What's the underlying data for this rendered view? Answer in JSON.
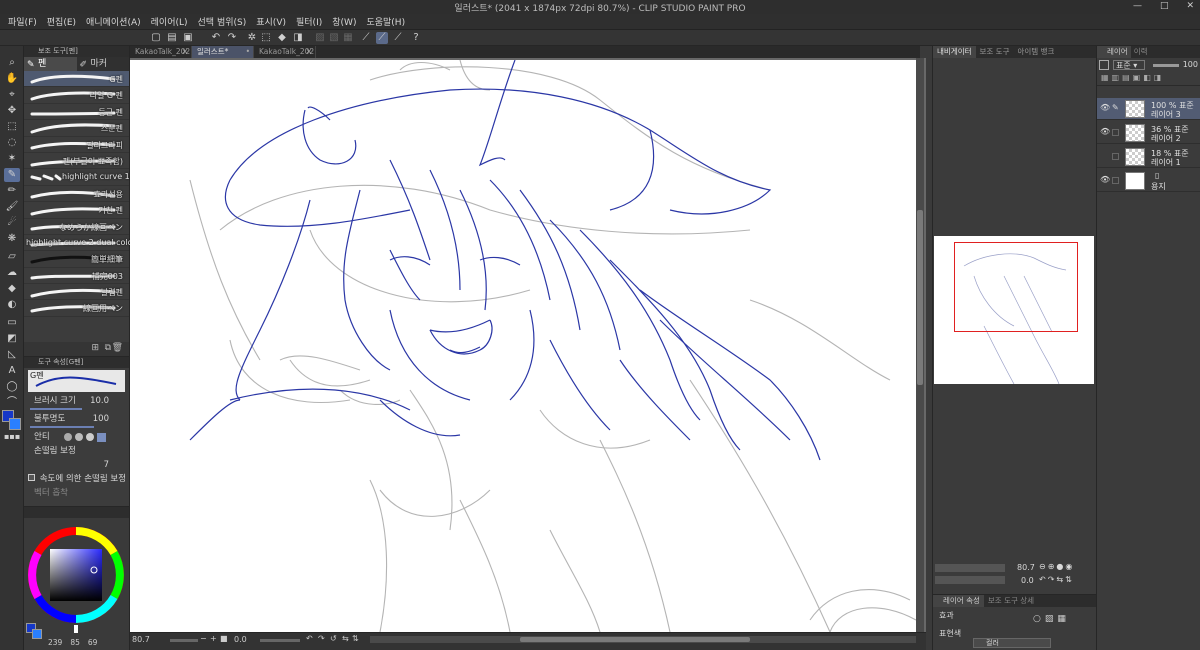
{
  "window": {
    "title": "일러스트* (2041 x 1874px 72dpi 80.7%)  - CLIP STUDIO PAINT PRO",
    "controls": [
      "—",
      "□",
      "✕"
    ]
  },
  "menu": [
    "파일(F)",
    "편집(E)",
    "애니메이션(A)",
    "레이어(L)",
    "선택 범위(S)",
    "표시(V)",
    "필터(I)",
    "창(W)",
    "도움말(H)"
  ],
  "subtool_panel": {
    "header": "보조 도구[펜]",
    "tabs": [
      {
        "label": "펜",
        "icon": "pen-icon"
      },
      {
        "label": "마커",
        "icon": "marker-icon"
      }
    ],
    "brushes": [
      "G펜",
      "리얼 G 펜",
      "둥근 펜",
      "스푼펜",
      "필리그라피",
      "펜(부글이 뾰족함)",
      "highlight curve 1",
      "효과선용",
      "거친 펜",
      "なめらか線画ペン",
      "highlight curve 2 dual color",
      "簡単細筆",
      "補完003",
      "날렵펜",
      "線画用ペン"
    ],
    "selected_index": 0
  },
  "tool_property": {
    "header": "도구 속성[G펜]",
    "name": "G펜",
    "brush_size_label": "브러시 크기",
    "brush_size_value": "10.0",
    "opacity_label": "불투명도",
    "opacity_value": "100",
    "antialias_label": "안티",
    "stabilization_label": "손떨림 보정",
    "stabilization_value": "7",
    "speed_stabilize_label": "속도에 의한 손떨림 보정",
    "vector_snap_label": "벡터 흡착"
  },
  "color": {
    "main": "#1537c8",
    "sub": "#2a7fff",
    "hsv": [
      "239",
      "85",
      "69"
    ],
    "wheel_square_hue": "#2a2a9a"
  },
  "doc_tabs": [
    {
      "label": "KakaoTalk_202",
      "active": false
    },
    {
      "label": "일러스트*",
      "active": true
    },
    {
      "label": "KakaoTalk_202",
      "active": false
    }
  ],
  "status": {
    "zoom": "80.7",
    "rotation": "0.0"
  },
  "navigator": {
    "tabs": [
      "내비게이터",
      "보조 도구",
      "아이템 뱅크"
    ],
    "zoom": "80.7",
    "rotation": "0.0"
  },
  "layers": {
    "tabs": [
      "레이어",
      "이력"
    ],
    "blend": "표준",
    "opacity": "100",
    "items": [
      {
        "opacity": "100 %",
        "blend": "표준",
        "name": "레이어 3",
        "selected": true,
        "visible": true,
        "thumb": "transparent",
        "pen": true
      },
      {
        "opacity": "36 %",
        "blend": "표준",
        "name": "레이어 2",
        "selected": false,
        "visible": true,
        "thumb": "transparent",
        "pen": false
      },
      {
        "opacity": "18 %",
        "blend": "표준",
        "name": "레이어 1",
        "selected": false,
        "visible": false,
        "thumb": "transparent",
        "pen": false
      },
      {
        "opacity": "",
        "blend": "",
        "name": "용지",
        "selected": false,
        "visible": true,
        "thumb": "white",
        "pen": false
      }
    ]
  },
  "layer_property": {
    "tabs": [
      "레이어 속성",
      "보조 도구 상세"
    ],
    "effect_label": "효과",
    "expression_label": "표현색",
    "expression_value": "컬러"
  },
  "accent": "#5a6f9a"
}
